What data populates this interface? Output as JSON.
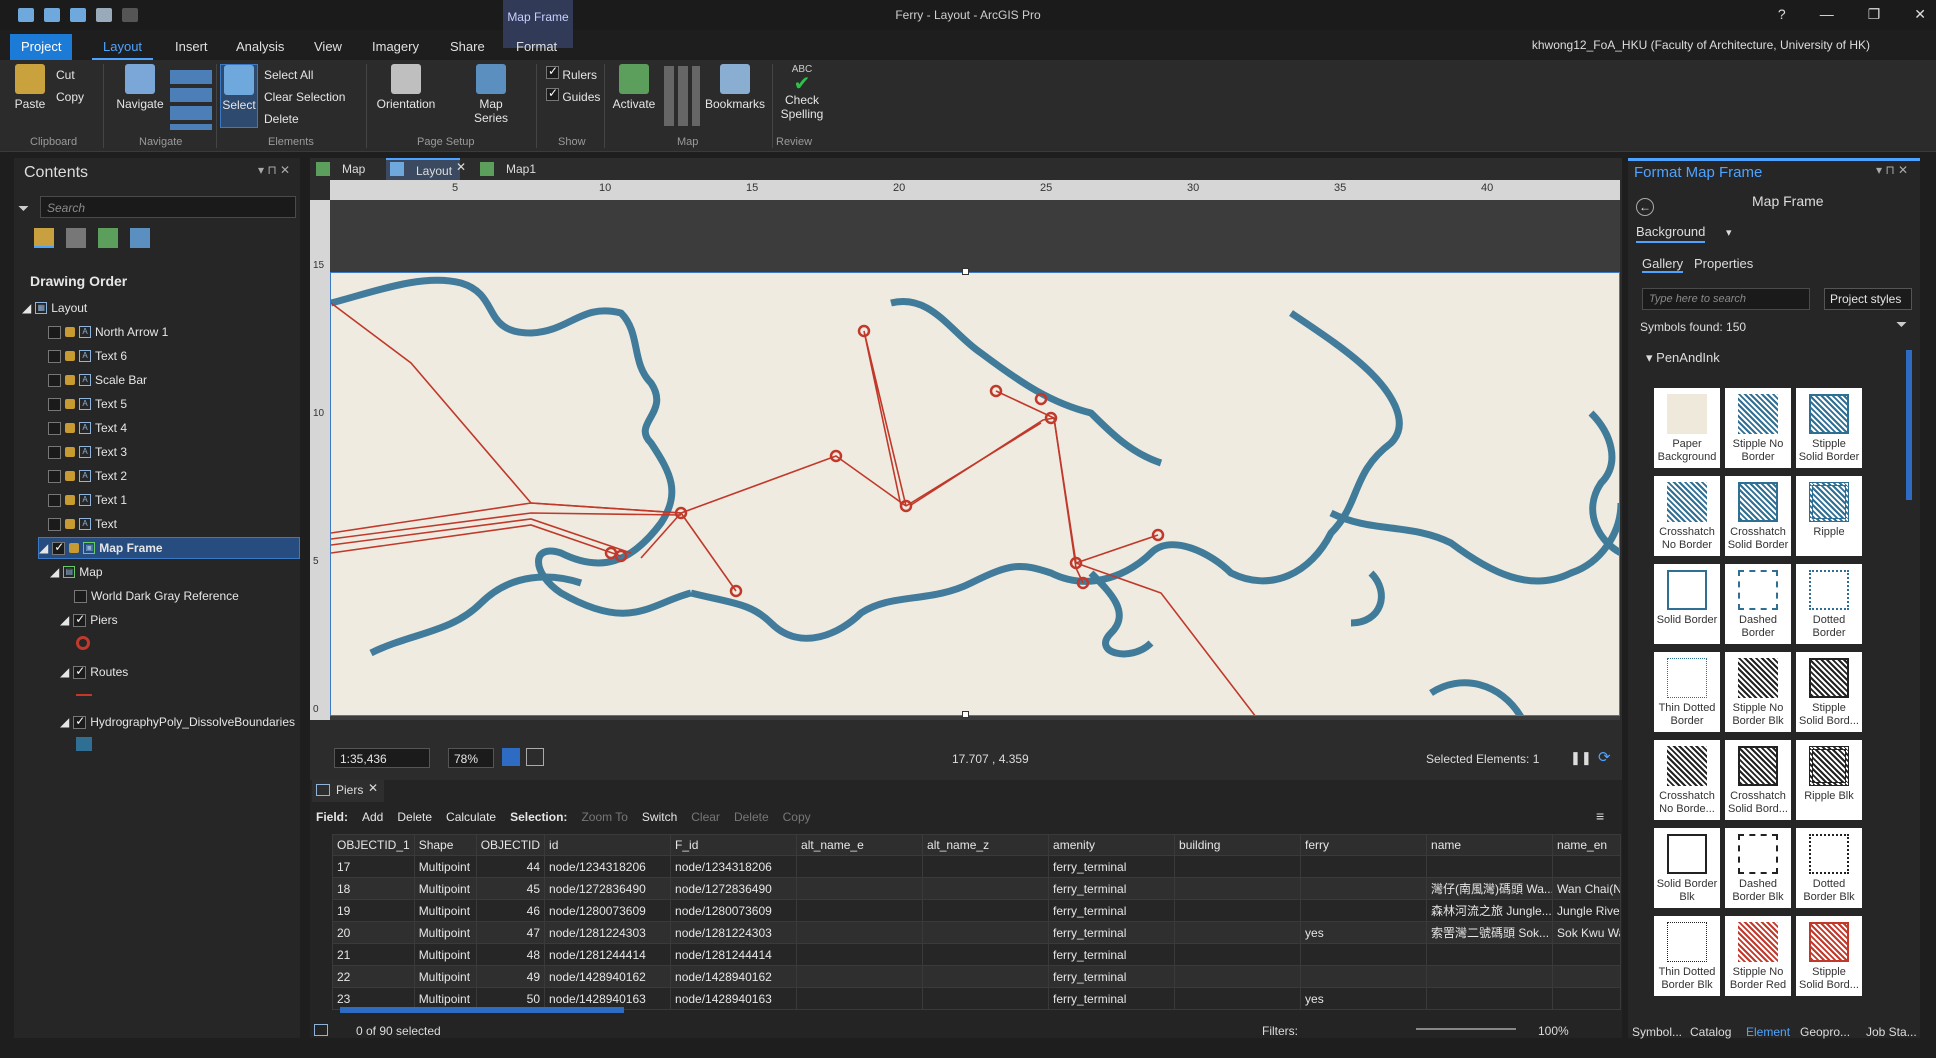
{
  "window": {
    "title": "Ferry - Layout - ArcGIS Pro",
    "contextual_tab_group": "Map Frame",
    "user": "khwong12_FoA_HKU (Faculty of Architecture, University of HK)",
    "help": "?",
    "minimize": "—",
    "restore": "❐",
    "close": "✕"
  },
  "ribbon": {
    "tabs": [
      "Project",
      "Layout",
      "Insert",
      "Analysis",
      "View",
      "Imagery",
      "Share",
      "Format"
    ],
    "active_tab": "Layout",
    "clipboard": {
      "paste": "Paste",
      "cut": "Cut",
      "copy": "Copy",
      "group": "Clipboard"
    },
    "navigate": {
      "navigate": "Navigate",
      "group": "Navigate"
    },
    "elements": {
      "select": "Select",
      "select_all": "Select All",
      "clear_selection": "Clear Selection",
      "delete": "Delete",
      "group": "Elements"
    },
    "page_setup": {
      "orientation": "Orientation",
      "map_series": "Map Series",
      "group": "Page Setup"
    },
    "show": {
      "rulers": "Rulers",
      "guides": "Guides",
      "group": "Show"
    },
    "map": {
      "activate": "Activate",
      "bookmarks": "Bookmarks",
      "group": "Map"
    },
    "review": {
      "abc": "ABC",
      "check_spelling_1": "Check",
      "check_spelling_2": "Spelling",
      "group": "Review"
    }
  },
  "contents": {
    "title": "Contents",
    "search_placeholder": "Search",
    "drawing_order": "Drawing Order",
    "layout_label": "Layout",
    "elements": [
      "North Arrow 1",
      "Text 6",
      "Scale Bar",
      "Text 5",
      "Text 4",
      "Text 3",
      "Text 2",
      "Text 1",
      "Text"
    ],
    "map_frame": "Map Frame",
    "map": "Map",
    "basemap": "World Dark Gray Reference",
    "layers": [
      "Piers",
      "Routes",
      "HydrographyPoly_DissolveBoundaries"
    ]
  },
  "doc_tabs": [
    "Map",
    "Layout",
    "Map1"
  ],
  "ruler": {
    "h_ticks": [
      "5",
      "10",
      "15",
      "20",
      "25",
      "30",
      "35",
      "40"
    ],
    "v_ticks": [
      "15",
      "10",
      "5",
      "0"
    ]
  },
  "layout_status": {
    "scale": "1:35,436",
    "zoom": "78%",
    "coords": "17.707 , 4.359",
    "selected": "Selected Elements: 1"
  },
  "attribute_table": {
    "tab": "Piers",
    "toolbar": {
      "field": "Field:",
      "add": "Add",
      "delete": "Delete",
      "calculate": "Calculate",
      "selection": "Selection:",
      "zoom_to": "Zoom To",
      "switch": "Switch",
      "clear": "Clear",
      "delete2": "Delete",
      "copy": "Copy"
    },
    "columns": [
      "OBJECTID_1",
      "Shape",
      "OBJECTID",
      "id",
      "F_id",
      "alt_name_e",
      "alt_name_z",
      "amenity",
      "building",
      "ferry",
      "name",
      "name_en"
    ],
    "rows": [
      [
        "17",
        "Multipoint",
        "44",
        "node/1234318206",
        "node/1234318206",
        "",
        "",
        "ferry_terminal",
        "",
        "",
        "",
        ""
      ],
      [
        "18",
        "Multipoint",
        "45",
        "node/1272836490",
        "node/1272836490",
        "",
        "",
        "ferry_terminal",
        "",
        "",
        "灣仔(南風灣)碼頭 Wa...",
        "Wan Chai(N"
      ],
      [
        "19",
        "Multipoint",
        "46",
        "node/1280073609",
        "node/1280073609",
        "",
        "",
        "ferry_terminal",
        "",
        "",
        "森林河流之旅 Jungle...",
        "Jungle River"
      ],
      [
        "20",
        "Multipoint",
        "47",
        "node/1281224303",
        "node/1281224303",
        "",
        "",
        "ferry_terminal",
        "",
        "yes",
        "索罟灣二號碼頭 Sok...",
        "Sok Kwu Wa"
      ],
      [
        "21",
        "Multipoint",
        "48",
        "node/1281244414",
        "node/1281244414",
        "",
        "",
        "ferry_terminal",
        "",
        "",
        "",
        ""
      ],
      [
        "22",
        "Multipoint",
        "49",
        "node/1428940162",
        "node/1428940162",
        "",
        "",
        "ferry_terminal",
        "",
        "",
        "",
        ""
      ],
      [
        "23",
        "Multipoint",
        "50",
        "node/1428940163",
        "node/1428940163",
        "",
        "",
        "ferry_terminal",
        "",
        "yes",
        "",
        ""
      ]
    ],
    "footer": {
      "selected": "0 of 90 selected",
      "filters": "Filters:",
      "zoom": "100%"
    }
  },
  "format_pane": {
    "title": "Format Map Frame",
    "subtitle": "Map Frame",
    "section": "Background",
    "tabs": [
      "Gallery",
      "Properties"
    ],
    "search_placeholder": "Type here to search",
    "styles": "Project styles",
    "count": "Symbols found: 150",
    "category": "PenAndInk",
    "symbols": [
      [
        "Paper",
        "Background"
      ],
      [
        "Stipple No",
        "Border"
      ],
      [
        "Stipple",
        "Solid Border"
      ],
      [
        "Crosshatch",
        "No Border"
      ],
      [
        "Crosshatch",
        "Solid Border"
      ],
      [
        "Ripple",
        ""
      ],
      [
        "Solid Border",
        ""
      ],
      [
        "Dashed",
        "Border"
      ],
      [
        "Dotted",
        "Border"
      ],
      [
        "Thin Dotted",
        "Border"
      ],
      [
        "Stipple No",
        "Border Blk"
      ],
      [
        "Stipple",
        "Solid Bord..."
      ],
      [
        "Crosshatch",
        "No Borde..."
      ],
      [
        "Crosshatch",
        "Solid Bord..."
      ],
      [
        "Ripple Blk",
        ""
      ],
      [
        "Solid Border",
        "Blk"
      ],
      [
        "Dashed",
        "Border Blk"
      ],
      [
        "Dotted",
        "Border Blk"
      ],
      [
        "Thin Dotted",
        "Border Blk"
      ],
      [
        "Stipple No",
        "Border Red"
      ],
      [
        "Stipple",
        "Solid Bord..."
      ]
    ],
    "bottom_tabs": [
      "Symbol...",
      "Catalog",
      "Element",
      "Geopro...",
      "Job Sta..."
    ]
  },
  "colors": {
    "accent": "#4ea3ff",
    "project_tab": "#1c7bd6",
    "route": "#c0392b",
    "coast": "#2f6f93",
    "paper": "#efebe0"
  }
}
